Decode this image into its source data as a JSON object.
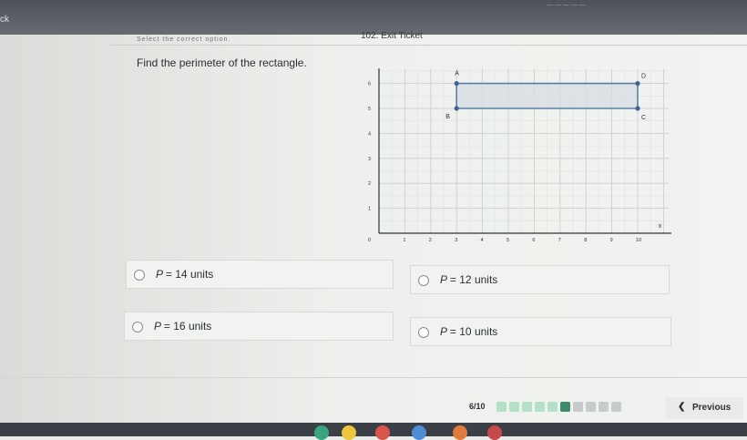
{
  "window": {
    "back_label": "ck",
    "caption": "— — — — —"
  },
  "header": {
    "title": "102. Exit Ticket",
    "instruction": "Select the correct option."
  },
  "question": {
    "text": "Find the perimeter of the rectangle."
  },
  "graph": {
    "x_ticks": [
      "0",
      "1",
      "2",
      "3",
      "4",
      "5",
      "6",
      "7",
      "8",
      "9",
      "10"
    ],
    "y_ticks": [
      "1",
      "2",
      "3",
      "4",
      "5",
      "6"
    ],
    "x_axis_label": "x",
    "points": [
      {
        "label": "A",
        "x": 3,
        "y": 6
      },
      {
        "label": "D",
        "x": 10,
        "y": 6
      },
      {
        "label": "B",
        "x": 3,
        "y": 5
      },
      {
        "label": "C",
        "x": 10,
        "y": 5
      }
    ],
    "colors": {
      "rectangle": "#5c7fa4",
      "fill": "#d7dde2",
      "points": "#3f6590"
    }
  },
  "options": [
    {
      "p": "P",
      "eq": "= 14",
      "unit": "units"
    },
    {
      "p": "P",
      "eq": "= 12",
      "unit": "units"
    },
    {
      "p": "P",
      "eq": "= 16",
      "unit": "units"
    },
    {
      "p": "P",
      "eq": "= 10",
      "unit": "units"
    }
  ],
  "footer": {
    "counter": "6/10",
    "progress": {
      "total": 10,
      "current": 6,
      "colors": {
        "answered": "#b3e0c7",
        "current": "#3e8b6a",
        "pending": "#c8cbcd"
      }
    },
    "previous_label": "Previous"
  },
  "taskbar": {
    "icon_colors": [
      "#3aa380",
      "#efc53b",
      "#d9574a",
      "#4f8ed6",
      "#e07a3d",
      "#c44a4a"
    ]
  }
}
